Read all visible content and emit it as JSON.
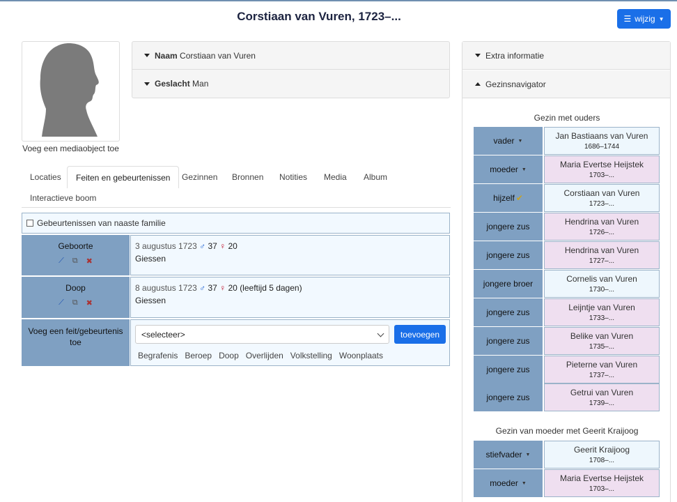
{
  "header": {
    "title": "Corstiaan van Vuren, 1723–...",
    "edit_label": "wijzig"
  },
  "media": {
    "add_label": "Voeg een mediaobject toe"
  },
  "summary": {
    "name_label": "Naam",
    "name_value": "Corstiaan van Vuren",
    "sex_label": "Geslacht",
    "sex_value": "Man"
  },
  "tabs": [
    "Locaties",
    "Feiten en gebeurtenissen",
    "Gezinnen",
    "Bronnen",
    "Notities",
    "Media",
    "Album",
    "Interactieve boom"
  ],
  "facts": {
    "family_events_label": "Gebeurtenissen van naaste familie",
    "items": [
      {
        "label": "Geboorte",
        "date": "3 augustus 1723",
        "father_age": "37",
        "mother_age": "20",
        "extra": "",
        "place": "Giessen"
      },
      {
        "label": "Doop",
        "date": "8 augustus 1723",
        "father_age": "37",
        "mother_age": "20",
        "extra": "(leeftijd 5 dagen)",
        "place": "Giessen"
      }
    ],
    "add_fact_label": "Voeg een feit/gebeurtenis toe",
    "select_placeholder": "<selecteer>",
    "add_button": "toevoegen",
    "quick_links": [
      "Begrafenis",
      "Beroep",
      "Doop",
      "Overlijden",
      "Volkstelling",
      "Woonplaats"
    ]
  },
  "sidebar": {
    "extra_info_label": "Extra informatie",
    "navigator_label": "Gezinsnavigator",
    "family1_title": "Gezin met ouders",
    "family1": [
      {
        "relation": "vader",
        "dropdown": true,
        "name": "Jan Bastiaans van Vuren",
        "dates": "1686–1744",
        "sex": "m"
      },
      {
        "relation": "moeder",
        "dropdown": true,
        "name": "Maria Evertse Heijstek",
        "dates": "1703–...",
        "sex": "f"
      },
      {
        "relation": "hijzelf",
        "dropdown": false,
        "name": "Corstiaan van Vuren",
        "dates": "1723–...",
        "sex": "m"
      },
      {
        "relation": "jongere zus",
        "dropdown": false,
        "name": "Hendrina van Vuren",
        "dates": "1726–...",
        "sex": "f"
      },
      {
        "relation": "jongere zus",
        "dropdown": false,
        "name": "Hendrina van Vuren",
        "dates": "1727–...",
        "sex": "f"
      },
      {
        "relation": "jongere broer",
        "dropdown": false,
        "name": "Cornelis van Vuren",
        "dates": "1730–...",
        "sex": "m"
      },
      {
        "relation": "jongere zus",
        "dropdown": false,
        "name": "Leijntje van Vuren",
        "dates": "1733–...",
        "sex": "f"
      },
      {
        "relation": "jongere zus",
        "dropdown": false,
        "name": "Belike van Vuren",
        "dates": "1735–...",
        "sex": "f"
      },
      {
        "relation": "jongere zus",
        "dropdown": false,
        "name": "Pieterne van Vuren",
        "dates": "1737–...",
        "sex": "f"
      },
      {
        "relation": "jongere zus",
        "dropdown": false,
        "name": "Getrui van Vuren",
        "dates": "1739–...",
        "sex": "f"
      }
    ],
    "family2_title": "Gezin van moeder met Geerit Kraijoog",
    "family2": [
      {
        "relation": "stiefvader",
        "dropdown": true,
        "name": "Geerit Kraijoog",
        "dates": "1708–...",
        "sex": "m"
      },
      {
        "relation": "moeder",
        "dropdown": true,
        "name": "Maria Evertse Heijstek",
        "dates": "1703–...",
        "sex": "f"
      }
    ]
  },
  "colors": {
    "accent": "#1a6fe8",
    "label_bg": "#7fa0c2",
    "male_bg": "#eef7fd",
    "female_bg": "#efdff0"
  }
}
